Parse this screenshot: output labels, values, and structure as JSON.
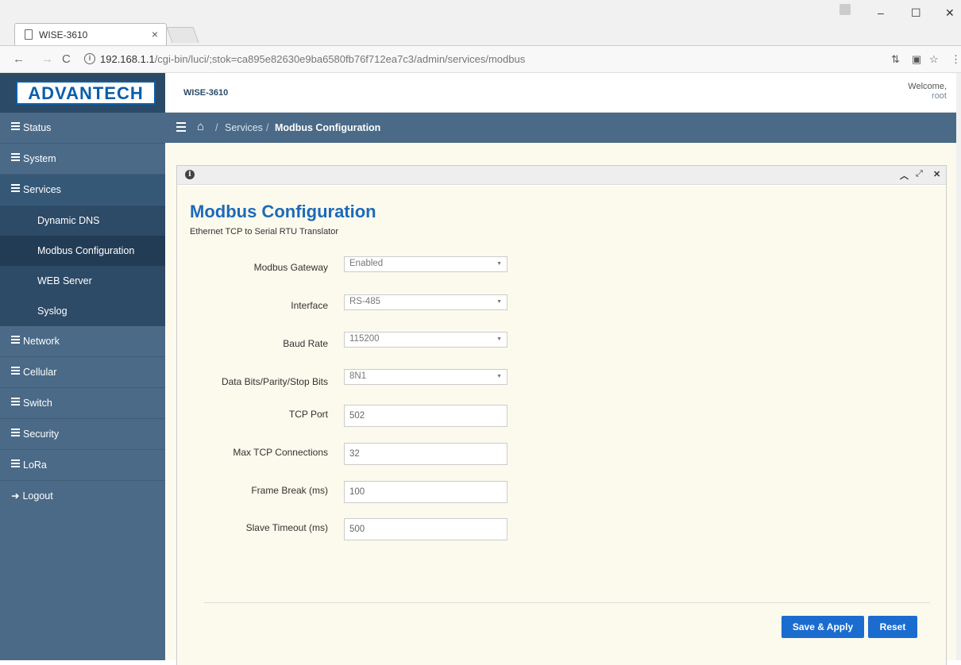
{
  "browser": {
    "tab_title": "WISE-3610",
    "tab_close": "×",
    "url_host": "192.168.1.1",
    "url_path": "/cgi-bin/luci/;stok=ca895e82630e9ba6580fb76f712ea7c3/admin/services/modbus",
    "window_min": "–",
    "window_max": "☐",
    "window_close": "✕"
  },
  "header": {
    "logo": "ADVANTECH",
    "device": "WISE-3610",
    "welcome": "Welcome,",
    "user": "root"
  },
  "sidebar": {
    "items": [
      {
        "label": "Status"
      },
      {
        "label": "System"
      },
      {
        "label": "Services"
      },
      {
        "label": "Network"
      },
      {
        "label": "Cellular"
      },
      {
        "label": "Switch"
      },
      {
        "label": "Security"
      },
      {
        "label": "LoRa"
      },
      {
        "label": "Logout"
      }
    ],
    "services_sub": [
      {
        "label": "Dynamic DNS"
      },
      {
        "label": "Modbus Configuration"
      },
      {
        "label": "WEB Server"
      },
      {
        "label": "Syslog"
      }
    ]
  },
  "breadcrumb": {
    "sep": "/",
    "services": "Services",
    "current": "Modbus Configuration"
  },
  "page": {
    "title": "Modbus Configuration",
    "subtitle": "Ethernet TCP to Serial RTU Translator"
  },
  "form": {
    "modbus_gateway": {
      "label": "Modbus Gateway",
      "value": "Enabled"
    },
    "interface": {
      "label": "Interface",
      "value": "RS-485"
    },
    "baud_rate": {
      "label": "Baud Rate",
      "value": "115200"
    },
    "data_bits": {
      "label": "Data Bits/Parity/Stop Bits",
      "value": "8N1"
    },
    "tcp_port": {
      "label": "TCP Port",
      "value": "502"
    },
    "max_tcp": {
      "label": "Max TCP Connections",
      "value": "32"
    },
    "frame_break": {
      "label": "Frame Break (ms)",
      "value": "100"
    },
    "slave_timeout": {
      "label": "Slave Timeout (ms)",
      "value": "500"
    }
  },
  "actions": {
    "save": "Save & Apply",
    "reset": "Reset"
  }
}
